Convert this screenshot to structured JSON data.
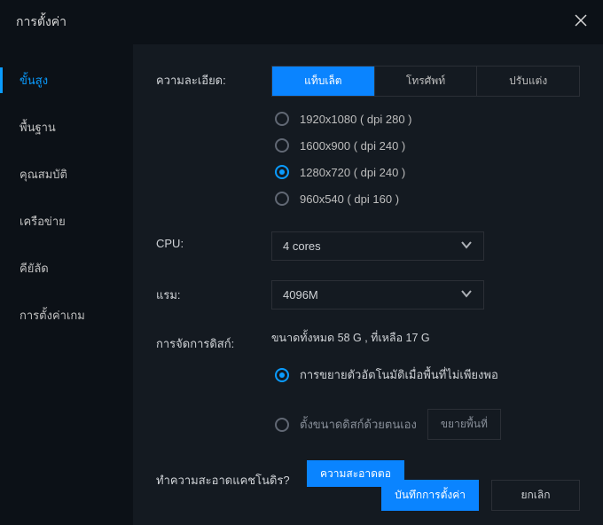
{
  "window": {
    "title": "การตั้งค่า"
  },
  "sidebar": {
    "items": [
      {
        "label": "ขั้นสูง",
        "active": true
      },
      {
        "label": "พื้นฐาน"
      },
      {
        "label": "คุณสมบัติ"
      },
      {
        "label": "เครือข่าย"
      },
      {
        "label": "คียัลัด"
      },
      {
        "label": "การตั้งค่าเกม"
      }
    ]
  },
  "resolution": {
    "label": "ความละเอียด:",
    "tabs": [
      {
        "label": "แท็บเล็ต",
        "active": true
      },
      {
        "label": "โทรศัพท์"
      },
      {
        "label": "ปรับแต่ง"
      }
    ],
    "options": [
      {
        "label": "1920x1080 ( dpi 280 )"
      },
      {
        "label": "1600x900 ( dpi 240 )"
      },
      {
        "label": "1280x720 ( dpi 240 )",
        "selected": true
      },
      {
        "label": "960x540 ( dpi 160 )"
      }
    ]
  },
  "cpu": {
    "label": "CPU:",
    "value": "4 cores"
  },
  "ram": {
    "label": "แรม:",
    "value": "4096M"
  },
  "disk": {
    "label": "การจัดการดิสก์:",
    "info": "ขนาดทั้งหมด 58 G ,  ที่เหลือ 17 G",
    "options": [
      {
        "label": "การขยายตัวอัตโนมัติเมื่อพื้นที่ไม่เพียงพอ",
        "selected": true
      },
      {
        "label": "ตั้งขนาดดิสก์ด้วยตนเอง"
      }
    ],
    "expand_btn": "ขยายพื้นที่"
  },
  "clean": {
    "label": "ทำความสะอาดแคชโนดิร?",
    "btn": "ความสะอาดตอ"
  },
  "footer": {
    "save": "บันทึกการตั้งค่า",
    "cancel": "ยกเลิก"
  }
}
